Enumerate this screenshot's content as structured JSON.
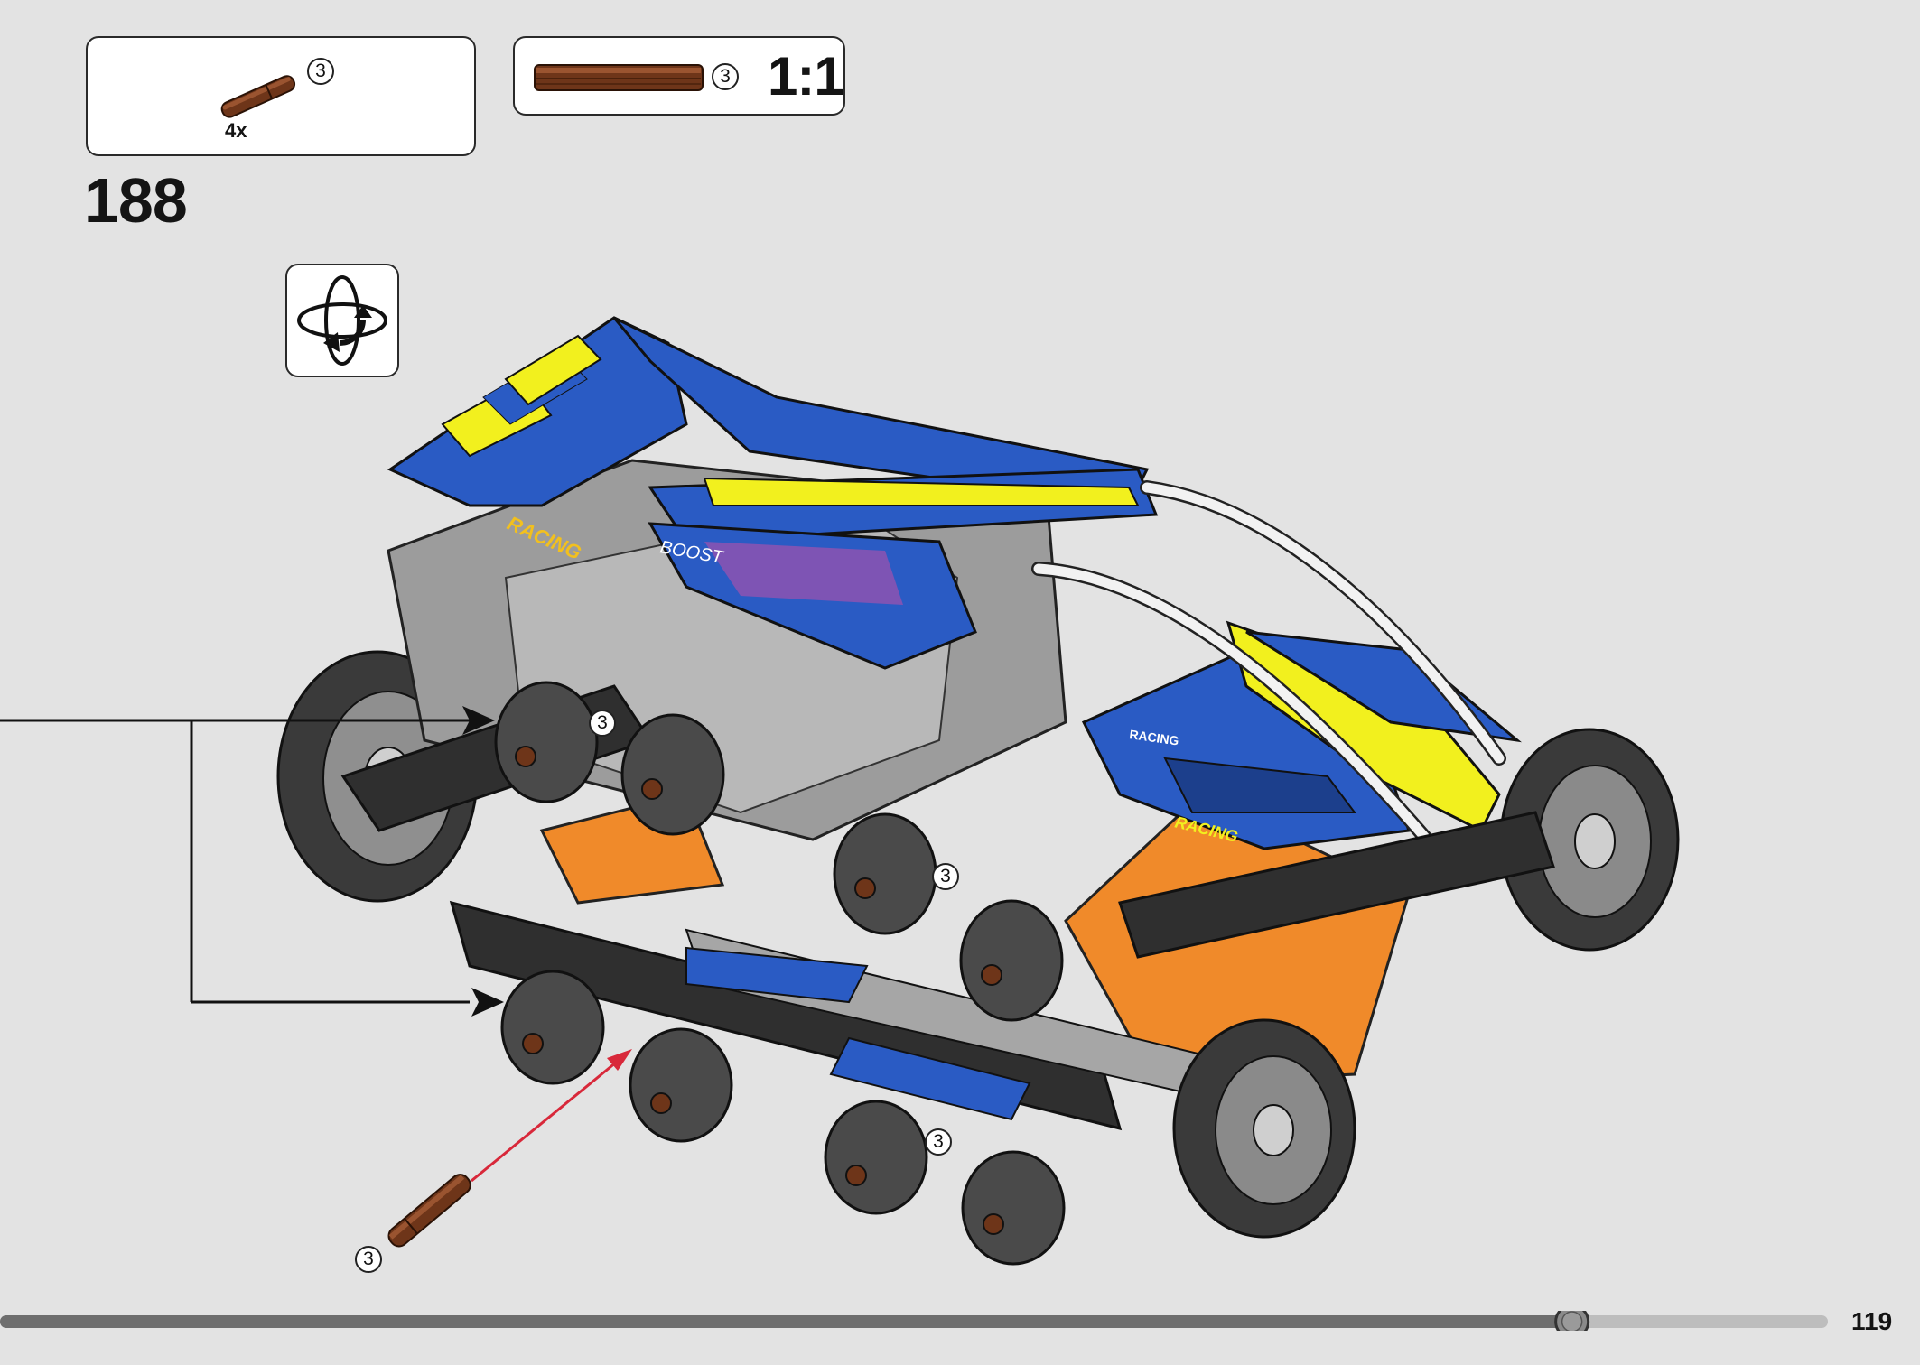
{
  "parts_callout": {
    "part": "friction-axle-pin-brown",
    "part_count": "3",
    "quantity": "4x"
  },
  "scale_callout": {
    "part": "axle-brown",
    "part_count": "3",
    "scale": "1:1"
  },
  "step": {
    "number": "188"
  },
  "rotate_icon": "rotate-model-icon",
  "model": {
    "callouts": [
      "3",
      "3",
      "3",
      "3"
    ],
    "decals": [
      "RACING",
      "RACING",
      "RACING",
      "BOOST"
    ]
  },
  "page": {
    "number": "119",
    "progress": 0.86
  },
  "colors": {
    "background": "#e3e3e3",
    "blue": "#2a5bc4",
    "yellow": "#f2f01e",
    "orange": "#f08a2a",
    "dark_gray": "#3d3d3d",
    "light_gray": "#a8a8a8",
    "brown": "#6e3519",
    "arrow_red": "#d8283a"
  }
}
